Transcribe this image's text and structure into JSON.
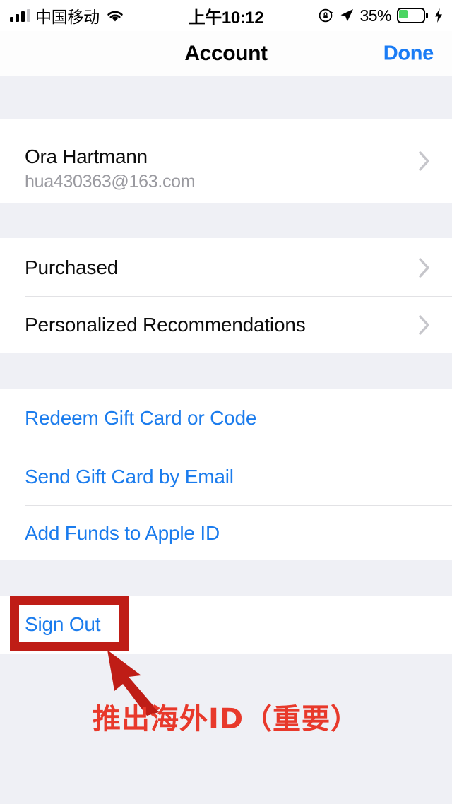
{
  "status_bar": {
    "carrier": "中国移动",
    "signal_icon": "cellular-bars-icon",
    "wifi_icon": "wifi-icon",
    "time": "上午10:12",
    "rotation_lock_icon": "rotation-lock-icon",
    "location_icon": "location-arrow-icon",
    "battery_percent": "35%",
    "battery_level": 35,
    "battery_icon": "battery-icon",
    "charging_icon": "lightning-bolt-icon",
    "battery_color": "#4cd563"
  },
  "navbar": {
    "title": "Account",
    "done_label": "Done",
    "accent_color": "#1a7cf5"
  },
  "sections": {
    "account": {
      "name": "Ora Hartmann",
      "email": "hua430363@163.com",
      "chevron_icon": "chevron-right-icon"
    },
    "library": [
      {
        "label": "Purchased",
        "chevron_icon": "chevron-right-icon"
      },
      {
        "label": "Personalized Recommendations",
        "chevron_icon": "chevron-right-icon"
      }
    ],
    "gift": [
      {
        "label": "Redeem Gift Card or Code"
      },
      {
        "label": "Send Gift Card by Email"
      },
      {
        "label": "Add Funds to Apple ID"
      }
    ],
    "signout": {
      "label": "Sign Out"
    }
  },
  "annotation": {
    "highlight_target": "Sign Out",
    "arrow_icon": "arrow-up-left-icon",
    "caption": "推出海外ID（重要）",
    "color": "#bf1d16",
    "text_color": "#e8392b"
  }
}
